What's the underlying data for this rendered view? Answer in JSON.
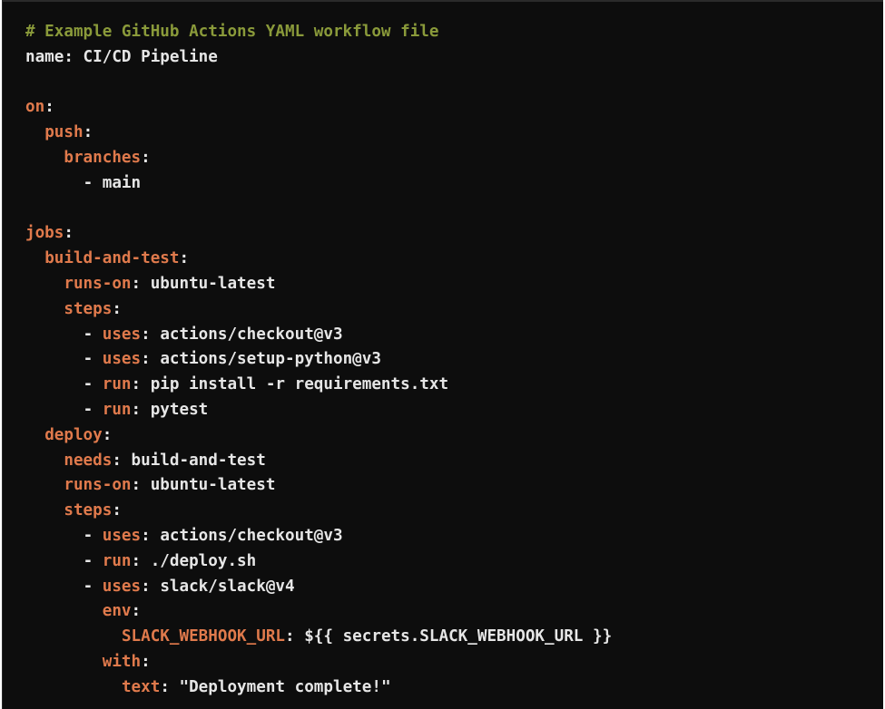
{
  "colors": {
    "background": "#0d0d0d",
    "comment": "#8a9a3a",
    "key": "#e07a4c",
    "value": "#e6e6e6"
  },
  "code_lines": [
    {
      "indent": "",
      "parts": [
        {
          "type": "comment",
          "text": "# Example GitHub Actions YAML workflow file"
        }
      ]
    },
    {
      "indent": "",
      "parts": [
        {
          "type": "value",
          "text": "name: CI/CD Pipeline"
        }
      ]
    },
    {
      "indent": "",
      "parts": []
    },
    {
      "indent": "",
      "parts": [
        {
          "type": "key",
          "text": "on"
        },
        {
          "type": "punct",
          "text": ":"
        }
      ]
    },
    {
      "indent": "  ",
      "parts": [
        {
          "type": "key",
          "text": "push"
        },
        {
          "type": "punct",
          "text": ":"
        }
      ]
    },
    {
      "indent": "    ",
      "parts": [
        {
          "type": "key",
          "text": "branches"
        },
        {
          "type": "punct",
          "text": ":"
        }
      ]
    },
    {
      "indent": "      ",
      "parts": [
        {
          "type": "punct",
          "text": "- "
        },
        {
          "type": "value",
          "text": "main"
        }
      ]
    },
    {
      "indent": "",
      "parts": []
    },
    {
      "indent": "",
      "parts": [
        {
          "type": "key",
          "text": "jobs"
        },
        {
          "type": "punct",
          "text": ":"
        }
      ]
    },
    {
      "indent": "  ",
      "parts": [
        {
          "type": "key",
          "text": "build-and-test"
        },
        {
          "type": "punct",
          "text": ":"
        }
      ]
    },
    {
      "indent": "    ",
      "parts": [
        {
          "type": "key",
          "text": "runs-on"
        },
        {
          "type": "punct",
          "text": ": "
        },
        {
          "type": "value",
          "text": "ubuntu-latest"
        }
      ]
    },
    {
      "indent": "    ",
      "parts": [
        {
          "type": "key",
          "text": "steps"
        },
        {
          "type": "punct",
          "text": ":"
        }
      ]
    },
    {
      "indent": "      ",
      "parts": [
        {
          "type": "punct",
          "text": "- "
        },
        {
          "type": "key",
          "text": "uses"
        },
        {
          "type": "punct",
          "text": ": "
        },
        {
          "type": "value",
          "text": "actions/checkout@v3"
        }
      ]
    },
    {
      "indent": "      ",
      "parts": [
        {
          "type": "punct",
          "text": "- "
        },
        {
          "type": "key",
          "text": "uses"
        },
        {
          "type": "punct",
          "text": ": "
        },
        {
          "type": "value",
          "text": "actions/setup-python@v3"
        }
      ]
    },
    {
      "indent": "      ",
      "parts": [
        {
          "type": "punct",
          "text": "- "
        },
        {
          "type": "key",
          "text": "run"
        },
        {
          "type": "punct",
          "text": ": "
        },
        {
          "type": "value",
          "text": "pip install -r requirements.txt"
        }
      ]
    },
    {
      "indent": "      ",
      "parts": [
        {
          "type": "punct",
          "text": "- "
        },
        {
          "type": "key",
          "text": "run"
        },
        {
          "type": "punct",
          "text": ": "
        },
        {
          "type": "value",
          "text": "pytest"
        }
      ]
    },
    {
      "indent": "  ",
      "parts": [
        {
          "type": "key",
          "text": "deploy"
        },
        {
          "type": "punct",
          "text": ":"
        }
      ]
    },
    {
      "indent": "    ",
      "parts": [
        {
          "type": "key",
          "text": "needs"
        },
        {
          "type": "punct",
          "text": ": "
        },
        {
          "type": "value",
          "text": "build-and-test"
        }
      ]
    },
    {
      "indent": "    ",
      "parts": [
        {
          "type": "key",
          "text": "runs-on"
        },
        {
          "type": "punct",
          "text": ": "
        },
        {
          "type": "value",
          "text": "ubuntu-latest"
        }
      ]
    },
    {
      "indent": "    ",
      "parts": [
        {
          "type": "key",
          "text": "steps"
        },
        {
          "type": "punct",
          "text": ":"
        }
      ]
    },
    {
      "indent": "      ",
      "parts": [
        {
          "type": "punct",
          "text": "- "
        },
        {
          "type": "key",
          "text": "uses"
        },
        {
          "type": "punct",
          "text": ": "
        },
        {
          "type": "value",
          "text": "actions/checkout@v3"
        }
      ]
    },
    {
      "indent": "      ",
      "parts": [
        {
          "type": "punct",
          "text": "- "
        },
        {
          "type": "key",
          "text": "run"
        },
        {
          "type": "punct",
          "text": ": "
        },
        {
          "type": "value",
          "text": "./deploy.sh"
        }
      ]
    },
    {
      "indent": "      ",
      "parts": [
        {
          "type": "punct",
          "text": "- "
        },
        {
          "type": "key",
          "text": "uses"
        },
        {
          "type": "punct",
          "text": ": "
        },
        {
          "type": "value",
          "text": "slack/slack@v4"
        }
      ]
    },
    {
      "indent": "        ",
      "parts": [
        {
          "type": "key",
          "text": "env"
        },
        {
          "type": "punct",
          "text": ":"
        }
      ]
    },
    {
      "indent": "          ",
      "parts": [
        {
          "type": "key",
          "text": "SLACK_WEBHOOK_URL"
        },
        {
          "type": "punct",
          "text": ": "
        },
        {
          "type": "value",
          "text": "${{ secrets.SLACK_WEBHOOK_URL }}"
        }
      ]
    },
    {
      "indent": "        ",
      "parts": [
        {
          "type": "key",
          "text": "with"
        },
        {
          "type": "punct",
          "text": ":"
        }
      ]
    },
    {
      "indent": "          ",
      "parts": [
        {
          "type": "key",
          "text": "text"
        },
        {
          "type": "punct",
          "text": ": "
        },
        {
          "type": "string",
          "text": "\"Deployment complete!\""
        }
      ]
    }
  ]
}
